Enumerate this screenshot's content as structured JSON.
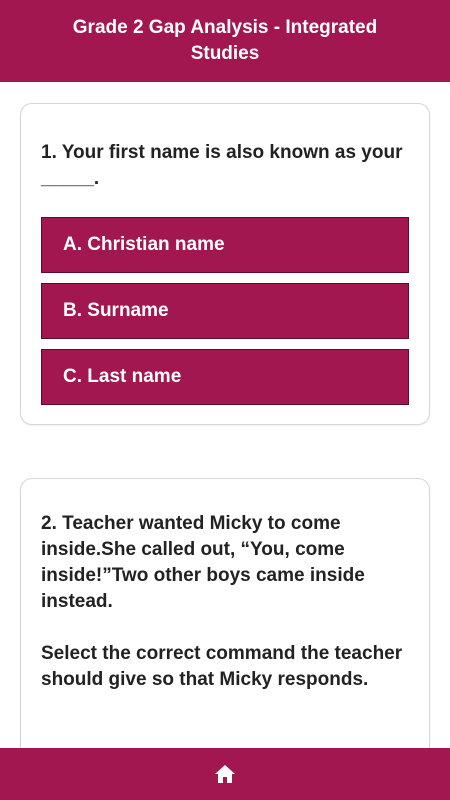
{
  "header": {
    "title": "Grade 2 Gap Analysis - Integrated Studies"
  },
  "questions": [
    {
      "text": "1. Your first name is also known as your _____.",
      "options": [
        "A. Christian name",
        "B. Surname",
        "C. Last name"
      ]
    },
    {
      "paragraphs": [
        "2. Teacher wanted Micky to come inside.She called out, “You, come inside!”Two other boys came inside instead.",
        "Select the correct command the teacher should give so that Micky responds."
      ]
    }
  ],
  "footer": {
    "home_icon": "home-icon"
  },
  "colors": {
    "accent": "#a31750",
    "option_border": "#5e0b2c",
    "card_border": "#d6d6d6"
  }
}
